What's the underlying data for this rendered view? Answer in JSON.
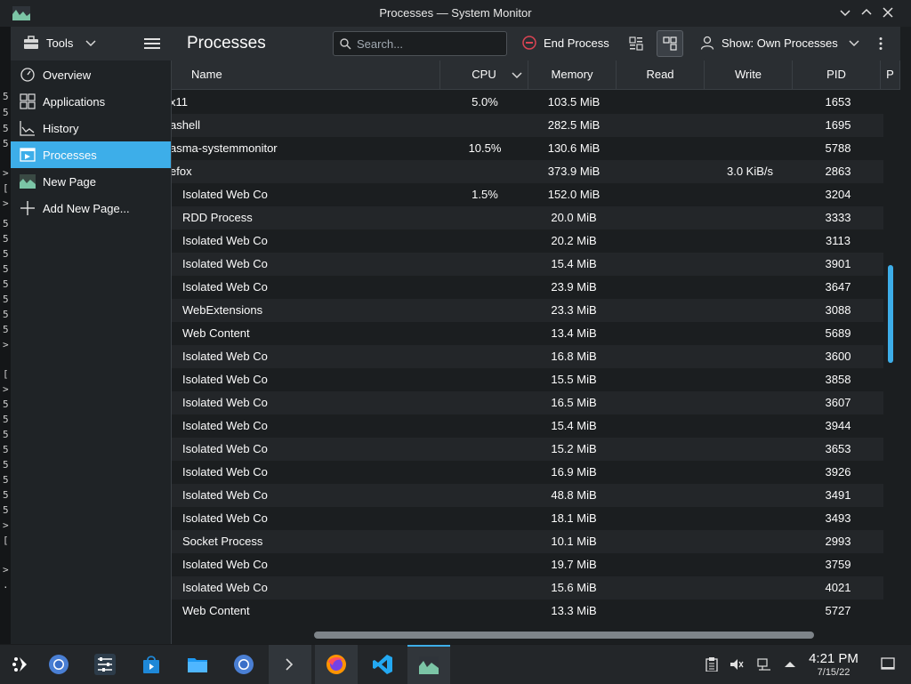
{
  "window": {
    "title": "Processes — System Monitor",
    "controls": [
      "minimize",
      "maximize",
      "close"
    ]
  },
  "toolbar": {
    "tools_label": "Tools",
    "page_title": "Processes",
    "search_placeholder": "Search...",
    "end_process_label": "End Process",
    "show_filter_label": "Show: Own Processes"
  },
  "sidebar": {
    "items": [
      {
        "label": "Overview",
        "icon": "speedometer-icon",
        "active": false
      },
      {
        "label": "Applications",
        "icon": "grid-icon",
        "active": false
      },
      {
        "label": "History",
        "icon": "chart-icon",
        "active": false
      },
      {
        "label": "Processes",
        "icon": "process-icon",
        "active": true
      },
      {
        "label": "New Page",
        "icon": "page-image-icon",
        "active": false
      },
      {
        "label": "Add New Page...",
        "icon": "plus-icon",
        "active": false
      }
    ]
  },
  "table": {
    "columns": [
      "Name",
      "CPU",
      "Memory",
      "Read",
      "Write",
      "PID",
      "P"
    ],
    "sort_column": "CPU",
    "rows": [
      {
        "name": "x11",
        "cpu": "5.0%",
        "memory": "103.5 MiB",
        "read": "",
        "write": "",
        "pid": "1653",
        "child": false
      },
      {
        "name": "ashell",
        "cpu": "",
        "memory": "282.5 MiB",
        "read": "",
        "write": "",
        "pid": "1695",
        "child": false
      },
      {
        "name": "asma-systemmonitor",
        "cpu": "10.5%",
        "memory": "130.6 MiB",
        "read": "",
        "write": "",
        "pid": "5788",
        "child": false
      },
      {
        "name": "efox",
        "cpu": "",
        "memory": "373.9 MiB",
        "read": "",
        "write": "3.0 KiB/s",
        "pid": "2863",
        "child": false
      },
      {
        "name": "Isolated Web Co",
        "cpu": "1.5%",
        "memory": "152.0 MiB",
        "read": "",
        "write": "",
        "pid": "3204",
        "child": true
      },
      {
        "name": "RDD Process",
        "cpu": "",
        "memory": "20.0 MiB",
        "read": "",
        "write": "",
        "pid": "3333",
        "child": true
      },
      {
        "name": "Isolated Web Co",
        "cpu": "",
        "memory": "20.2 MiB",
        "read": "",
        "write": "",
        "pid": "3113",
        "child": true
      },
      {
        "name": "Isolated Web Co",
        "cpu": "",
        "memory": "15.4 MiB",
        "read": "",
        "write": "",
        "pid": "3901",
        "child": true
      },
      {
        "name": "Isolated Web Co",
        "cpu": "",
        "memory": "23.9 MiB",
        "read": "",
        "write": "",
        "pid": "3647",
        "child": true
      },
      {
        "name": "WebExtensions",
        "cpu": "",
        "memory": "23.3 MiB",
        "read": "",
        "write": "",
        "pid": "3088",
        "child": true
      },
      {
        "name": "Web Content",
        "cpu": "",
        "memory": "13.4 MiB",
        "read": "",
        "write": "",
        "pid": "5689",
        "child": true
      },
      {
        "name": "Isolated Web Co",
        "cpu": "",
        "memory": "16.8 MiB",
        "read": "",
        "write": "",
        "pid": "3600",
        "child": true
      },
      {
        "name": "Isolated Web Co",
        "cpu": "",
        "memory": "15.5 MiB",
        "read": "",
        "write": "",
        "pid": "3858",
        "child": true
      },
      {
        "name": "Isolated Web Co",
        "cpu": "",
        "memory": "16.5 MiB",
        "read": "",
        "write": "",
        "pid": "3607",
        "child": true
      },
      {
        "name": "Isolated Web Co",
        "cpu": "",
        "memory": "15.4 MiB",
        "read": "",
        "write": "",
        "pid": "3944",
        "child": true
      },
      {
        "name": "Isolated Web Co",
        "cpu": "",
        "memory": "15.2 MiB",
        "read": "",
        "write": "",
        "pid": "3653",
        "child": true
      },
      {
        "name": "Isolated Web Co",
        "cpu": "",
        "memory": "16.9 MiB",
        "read": "",
        "write": "",
        "pid": "3926",
        "child": true
      },
      {
        "name": "Isolated Web Co",
        "cpu": "",
        "memory": "48.8 MiB",
        "read": "",
        "write": "",
        "pid": "3491",
        "child": true
      },
      {
        "name": "Isolated Web Co",
        "cpu": "",
        "memory": "18.1 MiB",
        "read": "",
        "write": "",
        "pid": "3493",
        "child": true
      },
      {
        "name": "Socket Process",
        "cpu": "",
        "memory": "10.1 MiB",
        "read": "",
        "write": "",
        "pid": "2993",
        "child": true
      },
      {
        "name": "Isolated Web Co",
        "cpu": "",
        "memory": "19.7 MiB",
        "read": "",
        "write": "",
        "pid": "3759",
        "child": true
      },
      {
        "name": "Isolated Web Co",
        "cpu": "",
        "memory": "15.6 MiB",
        "read": "",
        "write": "",
        "pid": "4021",
        "child": true
      },
      {
        "name": "Web Content",
        "cpu": "",
        "memory": "13.3 MiB",
        "read": "",
        "write": "",
        "pid": "5727",
        "child": true
      }
    ]
  },
  "background_terminal": {
    "chars": [
      "5",
      "5",
      "5",
      "5",
      ">",
      "[",
      ">",
      "5",
      "5",
      "5",
      "5",
      "5",
      "5",
      "5",
      "5",
      ">",
      "[",
      ">",
      "5",
      "5",
      "5",
      "5",
      "5",
      "5",
      "5",
      "5",
      ">",
      "[",
      ">",
      "."
    ]
  },
  "taskbar": {
    "apps": [
      "app-launcher-icon",
      "chromium-icon",
      "settings-icon",
      "discover-store-icon",
      "file-manager-icon",
      "chromium-icon",
      "terminal-icon",
      "firefox-icon",
      "vscode-icon",
      "system-monitor-icon"
    ],
    "tray": [
      "clipboard-icon",
      "volume-muted-icon",
      "network-icon",
      "expand-tray-icon"
    ],
    "clock_time": "4:21 PM",
    "clock_date": "7/15/22"
  },
  "colors": {
    "accent": "#3daee9",
    "window_bg": "#1b1e20",
    "toolbar_bg": "#2a2e32",
    "end_process_red": "#da4453"
  }
}
